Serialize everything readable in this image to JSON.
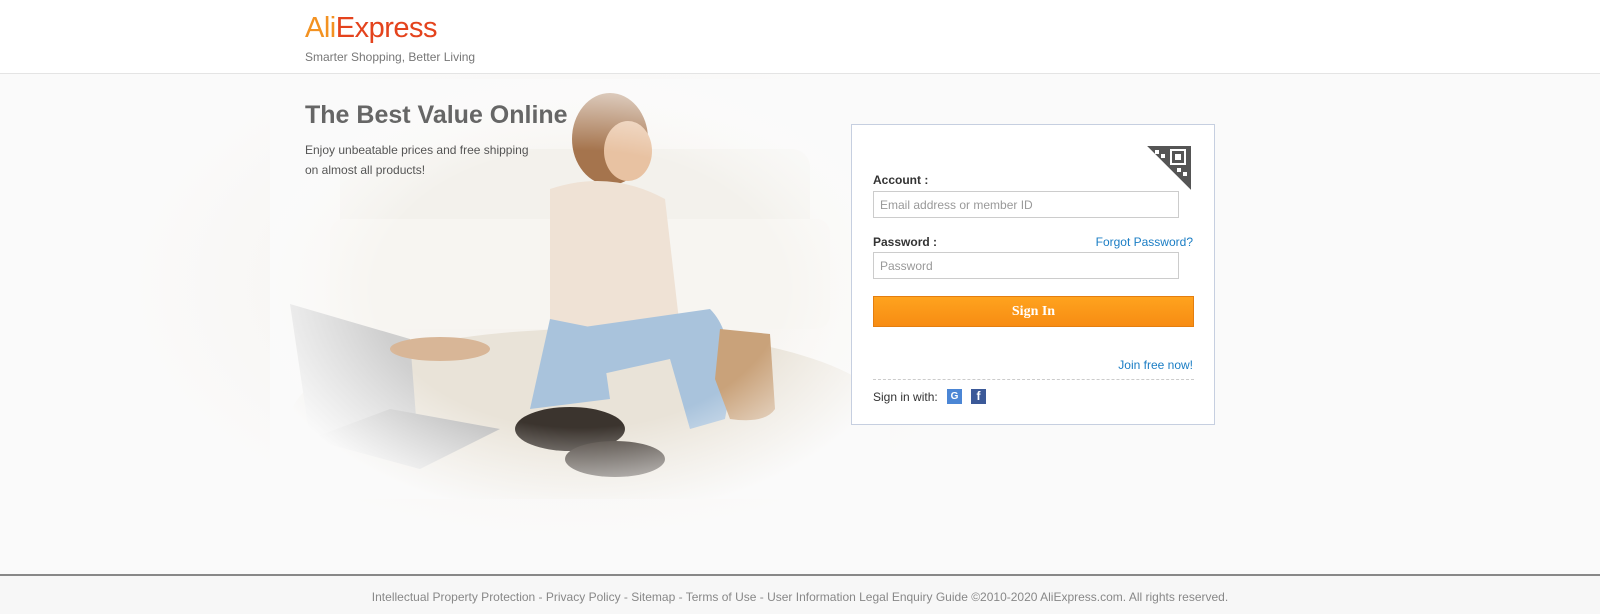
{
  "header": {
    "logo": {
      "part1": "Ali",
      "part2": "Express"
    },
    "tagline": "Smarter Shopping, Better Living"
  },
  "hero": {
    "title": "The Best Value Online",
    "subtitle_line1": "Enjoy unbeatable prices and free shipping",
    "subtitle_line2": "on almost all products!"
  },
  "login": {
    "account_label": "Account :",
    "account_placeholder": "Email address or member ID",
    "password_label": "Password :",
    "password_placeholder": "Password",
    "forgot_label": "Forgot Password?",
    "signin_label": "Sign In",
    "join_label": "Join free now!",
    "sns_label": "Sign in with:",
    "google_glyph": "G",
    "facebook_glyph": "f"
  },
  "footer": {
    "links": [
      "Intellectual Property Protection",
      "Privacy Policy",
      "Sitemap",
      "Terms of Use",
      "User Information Legal Enquiry Guide"
    ],
    "separator": " - ",
    "copyright": "©2010-2020 AliExpress.com. All rights reserved."
  },
  "colors": {
    "accent": "#f78c13",
    "link": "#1a7dc4",
    "logo_orange": "#f39221",
    "logo_red": "#e4431d"
  }
}
